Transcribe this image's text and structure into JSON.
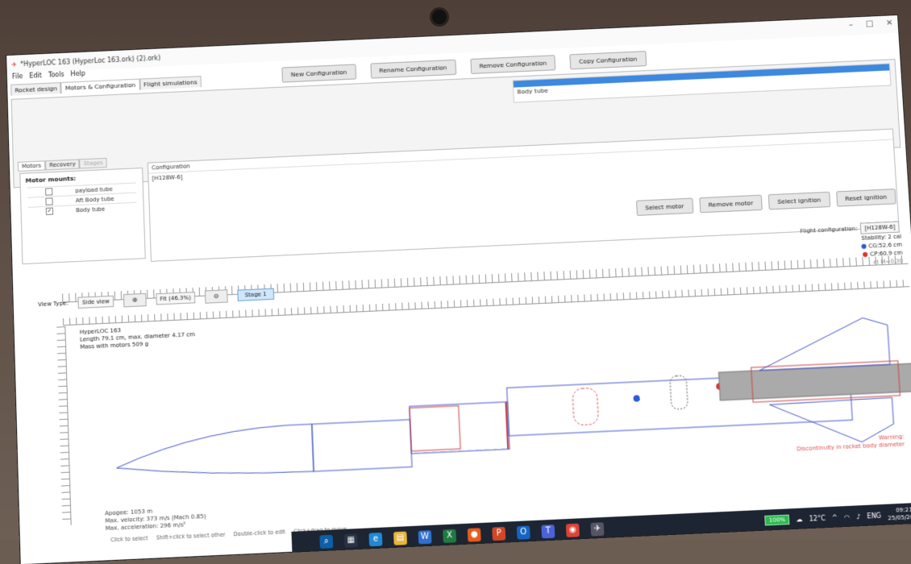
{
  "window": {
    "title": "*HyperLOC 163 (HyperLoc 163.ork) (2).ork)"
  },
  "menu": [
    "File",
    "Edit",
    "Tools",
    "Help"
  ],
  "tabs": [
    "Rocket design",
    "Motors & Configuration",
    "Flight simulations"
  ],
  "config_buttons": [
    "New Configuration",
    "Rename Configuration",
    "Remove Configuration",
    "Copy Configuration"
  ],
  "config_list": {
    "rows": [
      "Body tube",
      "[H128W-6]"
    ]
  },
  "subtabs": [
    "Motors",
    "Recovery",
    "Stages"
  ],
  "motor_mounts": {
    "title": "Motor mounts:",
    "items": [
      {
        "label": "payload tube",
        "checked": false
      },
      {
        "label": "Aft Body tube",
        "checked": false
      },
      {
        "label": "Body tube",
        "checked": true
      }
    ]
  },
  "motor_table": {
    "header": "Configuration",
    "cell": "[H128W-6]"
  },
  "motor_buttons": [
    "Select motor",
    "Remove motor",
    "Select ignition",
    "Reset ignition"
  ],
  "flight_config": {
    "label": "Flight configuration:",
    "value": "[H128W-6]"
  },
  "view": {
    "type_label": "View Type:",
    "type_value": "Side view",
    "zoom": "Fit (46.3%)",
    "stage": "Stage 1"
  },
  "stability": {
    "label": "Stability:",
    "value": "2 cal",
    "cg": "CG:52.6 cm",
    "cp": "CP:60.9 cm",
    "mach": "at M=0.30"
  },
  "rocket_info": {
    "name": "HyperLOC 163",
    "line1": "Length 79.1 cm, max. diameter 4.17 cm",
    "line2": "Mass with motors 509 g"
  },
  "warning": {
    "title": "Warning:",
    "text": "Discontinuity in rocket body diameter"
  },
  "sim_stats": {
    "apogee": "Apogee:      1053 m",
    "velocity": "Max. velocity:   373 m/s  (Mach 0.85)",
    "accel": "Max. acceleration: 296 m/s²"
  },
  "status_hints": [
    "Click to select",
    "Shift+click to select other",
    "Double-click to edit",
    "Click+drag to move"
  ],
  "taskbar": {
    "battery": "100%",
    "weather": "12°C",
    "lang": "ENG",
    "time": "09:21",
    "date": "25/05/2022"
  },
  "colors": {
    "accent": "#3d88e0",
    "cg": "#2a5ad8",
    "cp": "#e03030",
    "outline": "#4a5bd0"
  }
}
